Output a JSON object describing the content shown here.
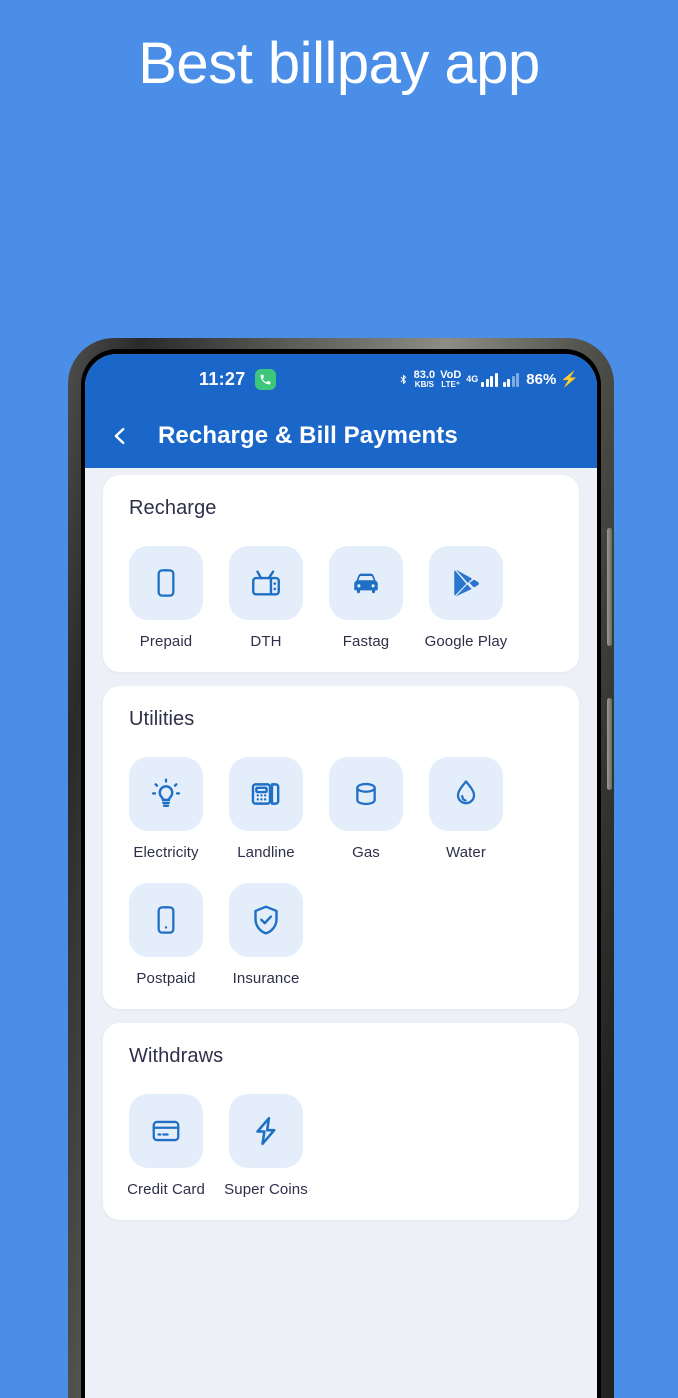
{
  "headline": "Best billpay app",
  "colors": {
    "page_background": "#4a8ee8",
    "header_blue": "#1b66c9",
    "screen_background": "#eef0f7",
    "card": "#ffffff",
    "tile_background": "#e4eefb",
    "icon_blue": "#1f6fc4",
    "text_dark": "#2e2f48",
    "call_badge_green": "#3ec77a",
    "charging_green": "#33dd6e"
  },
  "status_bar": {
    "time": "11:27",
    "call_icon": "phone-icon",
    "bluetooth_icon": "bluetooth-icon",
    "data_speed_value": "83.0",
    "data_speed_unit": "KB/S",
    "volte_top": "VoD",
    "volte_bottom": "LTE⁺",
    "network_type": "4G",
    "battery_percent": "86%",
    "charging_icon": "charging-bolt-icon"
  },
  "appbar": {
    "back_icon": "chevron-left-icon",
    "title": "Recharge & Bill Payments"
  },
  "sections": [
    {
      "title": "Recharge",
      "rows": [
        [
          {
            "label": "Prepaid",
            "icon": "smartphone-icon"
          },
          {
            "label": "DTH",
            "icon": "television-icon"
          },
          {
            "label": "Fastag",
            "icon": "car-icon"
          },
          {
            "label": "Google Play",
            "icon": "google-play-icon"
          }
        ]
      ]
    },
    {
      "title": "Utilities",
      "rows": [
        [
          {
            "label": "Electricity",
            "icon": "lightbulb-icon"
          },
          {
            "label": "Landline",
            "icon": "desk-phone-icon"
          },
          {
            "label": "Gas",
            "icon": "gas-cylinder-icon"
          },
          {
            "label": "Water",
            "icon": "water-drop-icon"
          }
        ],
        [
          {
            "label": "Postpaid",
            "icon": "smartphone-dot-icon"
          },
          {
            "label": "Insurance",
            "icon": "shield-check-icon"
          }
        ]
      ]
    },
    {
      "title": "Withdraws",
      "rows": [
        [
          {
            "label": "Credit Card",
            "icon": "credit-card-icon"
          },
          {
            "label": "Super Coins",
            "icon": "lightning-bolt-icon"
          }
        ]
      ]
    }
  ]
}
